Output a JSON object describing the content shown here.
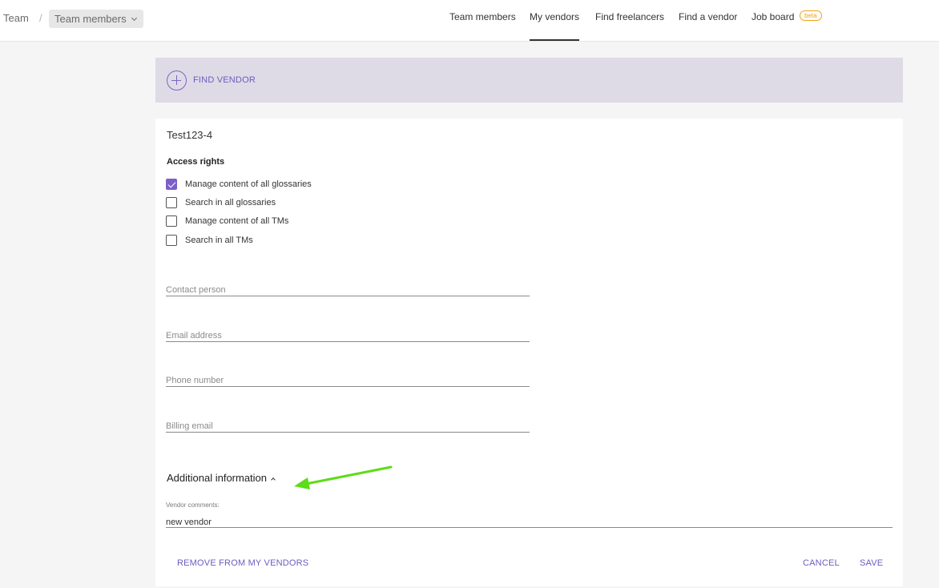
{
  "header": {
    "breadcrumb_root": "Team",
    "breadcrumb_separator": "/",
    "breadcrumb_select": "Team members",
    "nav": [
      {
        "label": "Team members",
        "active": false
      },
      {
        "label": "My vendors",
        "active": true
      },
      {
        "label": "Find freelancers",
        "active": false
      },
      {
        "label": "Find a vendor",
        "active": false
      },
      {
        "label": "Job board",
        "active": false
      }
    ],
    "beta_badge": "beta"
  },
  "banner": {
    "label": "FIND VENDOR",
    "icon": "plus-circle-icon"
  },
  "vendor": {
    "name": "Test123-4",
    "access_rights_title": "Access rights",
    "access_rights": [
      {
        "label": "Manage content of all glossaries",
        "checked": true
      },
      {
        "label": "Search in all glossaries",
        "checked": false
      },
      {
        "label": "Manage content of all TMs",
        "checked": false
      },
      {
        "label": "Search in all TMs",
        "checked": false
      }
    ],
    "fields": [
      {
        "placeholder": "Contact person",
        "value": ""
      },
      {
        "placeholder": "Email address",
        "value": ""
      },
      {
        "placeholder": "Phone number",
        "value": ""
      },
      {
        "placeholder": "Billing email",
        "value": ""
      }
    ],
    "additional_info_title": "Additional information",
    "comments_label": "Vendor comments:",
    "comments_value": "new vendor"
  },
  "actions": {
    "remove_label": "REMOVE FROM MY VENDORS",
    "cancel_label": "CANCEL",
    "save_label": "SAVE"
  },
  "colors": {
    "accent": "#7b5fc9",
    "banner_bg": "#dedbe6",
    "beta": "#f0a21a",
    "annotation_arrow": "#5ddc1a"
  }
}
